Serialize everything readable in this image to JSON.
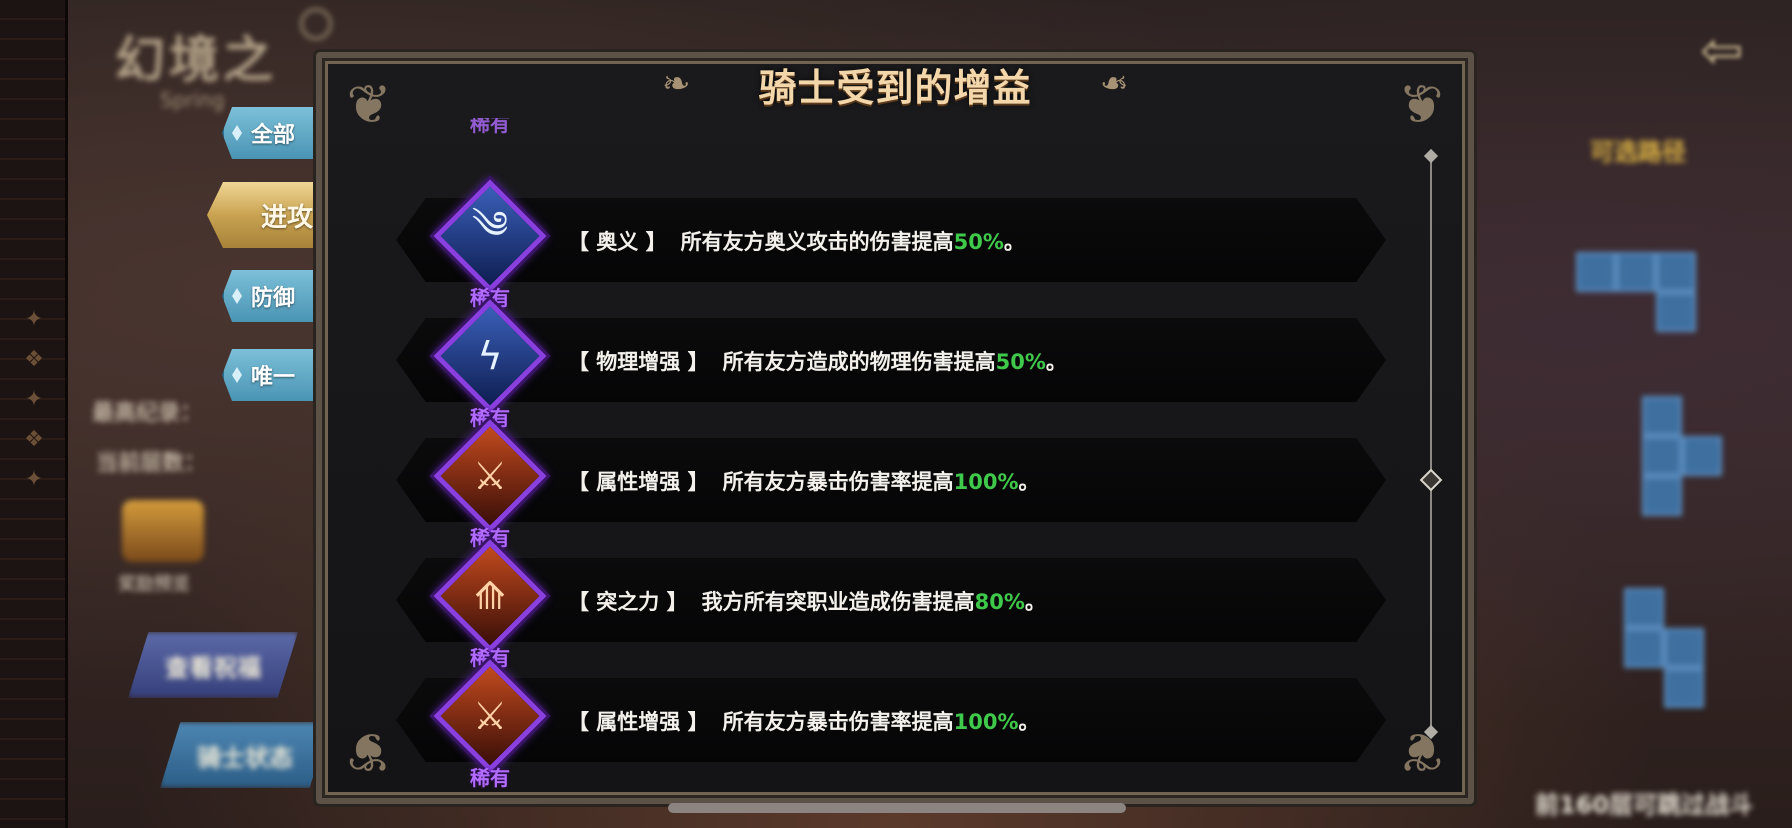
{
  "background": {
    "game_title": "幻境之",
    "game_subtitle": "Spring",
    "stat_best": "最高纪录：",
    "stat_current": "当前层数：",
    "reward_label": "奖励预览",
    "view_blessing": "查看祝福",
    "knight_status": "骑士状态",
    "route_label": "可选路径",
    "bottom_note": "前160层可跳过战斗"
  },
  "tabs": [
    {
      "label": "全部",
      "active": false
    },
    {
      "label": "进攻",
      "active": true
    },
    {
      "label": "防御",
      "active": false
    },
    {
      "label": "唯一",
      "active": false
    }
  ],
  "panel": {
    "title": "骑士受到的增益",
    "peek_rarity": "稀有"
  },
  "buffs": [
    {
      "name": "【 奥义 】",
      "description": "所有友方奥义攻击的伤害提高",
      "value": "50%",
      "suffix": "。",
      "rarity": "稀有",
      "icon": "wind-slash-icon",
      "icon_style": "blue"
    },
    {
      "name": "【 物理增强 】",
      "description": "所有友方造成的物理伤害提高",
      "value": "50%",
      "suffix": "。",
      "rarity": "稀有",
      "icon": "lightning-strike-icon",
      "icon_style": "blue"
    },
    {
      "name": "【 属性增强 】",
      "description": "所有友方暴击伤害率提高",
      "value": "100%",
      "suffix": "。",
      "rarity": "稀有",
      "icon": "flaming-sword-icon",
      "icon_style": "orange"
    },
    {
      "name": "【 突之力 】",
      "description": "我方所有突职业造成伤害提高",
      "value": "80%",
      "suffix": "。",
      "rarity": "稀有",
      "icon": "lance-icon",
      "icon_style": "orange"
    },
    {
      "name": "【 属性增强 】",
      "description": "所有友方暴击伤害率提高",
      "value": "100%",
      "suffix": "。",
      "rarity": "稀有",
      "icon": "flaming-sword-icon",
      "icon_style": "orange"
    }
  ],
  "colors": {
    "accent_gold": "#f3d7aa",
    "rarity_purple": "#b26cff",
    "value_green": "#3fc94a",
    "route_yellow": "#e2b845"
  }
}
